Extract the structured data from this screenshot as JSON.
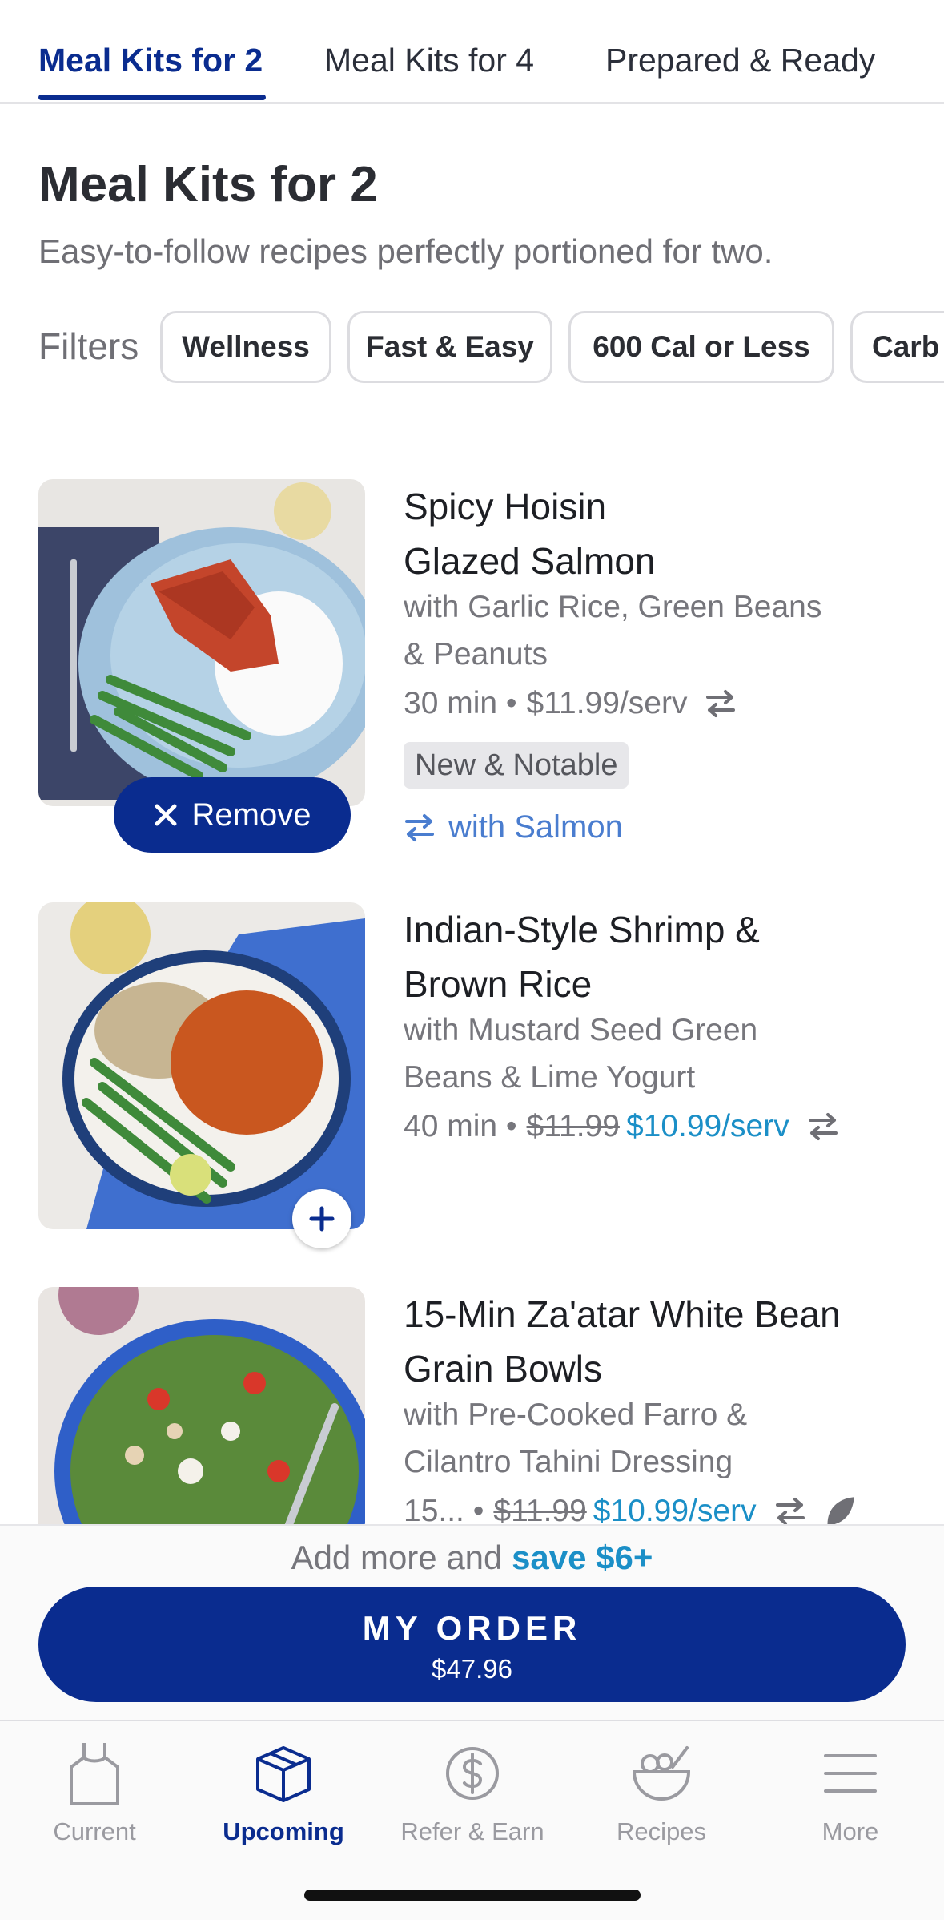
{
  "top_tabs": [
    {
      "label": "Meal Kits for 2",
      "active": true
    },
    {
      "label": "Meal Kits for 4",
      "active": false
    },
    {
      "label": "Prepared & Ready",
      "active": false
    }
  ],
  "heading": {
    "title": "Meal Kits for 2",
    "subtitle": "Easy-to-follow recipes perfectly portioned for two."
  },
  "filters": {
    "label": "Filters",
    "chips": [
      "Wellness",
      "Fast & Easy",
      "600 Cal or Less",
      "Carb"
    ]
  },
  "recipes": [
    {
      "title_line1": "Spicy Hoisin",
      "title_line2": "Glazed Salmon",
      "subtitle_line1": "with Garlic Rice, Green Beans",
      "subtitle_line2": "& Peanuts",
      "time": "30 min •",
      "price": "$11.99/serv",
      "badge": "New & Notable",
      "swap_link": "with Salmon",
      "action": "Remove",
      "in_order": true
    },
    {
      "title_line1": "Indian-Style Shrimp &",
      "title_line2": "Brown Rice",
      "subtitle_line1": "with Mustard Seed Green",
      "subtitle_line2": "Beans & Lime Yogurt",
      "time": "40 min •",
      "original_price": "$11.99",
      "sale_price": "$10.99/serv",
      "in_order": false
    },
    {
      "title_line1": "15-Min Za'atar White Bean",
      "title_line2": "Grain Bowls",
      "subtitle_line1": "with Pre-Cooked Farro &",
      "subtitle_line2": "Cilantro Tahini Dressing",
      "time": "15... •",
      "original_price": "$11.99",
      "sale_price": "$10.99/serv",
      "in_order": false
    }
  ],
  "order_bar": {
    "promo_prefix": "Add more and ",
    "promo_accent": "save $6+",
    "button_label": "MY ORDER",
    "total": "$47.96"
  },
  "bottom_nav": [
    {
      "label": "Current",
      "icon": "apron-icon",
      "active": false
    },
    {
      "label": "Upcoming",
      "icon": "box-icon",
      "active": true
    },
    {
      "label": "Refer & Earn",
      "icon": "dollar-circle-icon",
      "active": false
    },
    {
      "label": "Recipes",
      "icon": "bowl-icon",
      "active": false
    },
    {
      "label": "More",
      "icon": "menu-icon",
      "active": false
    }
  ],
  "colors": {
    "brand_navy": "#0a2c8f",
    "accent_blue": "#1b8fc7",
    "link_blue": "#4a7dcf",
    "muted_text": "#76767c"
  }
}
